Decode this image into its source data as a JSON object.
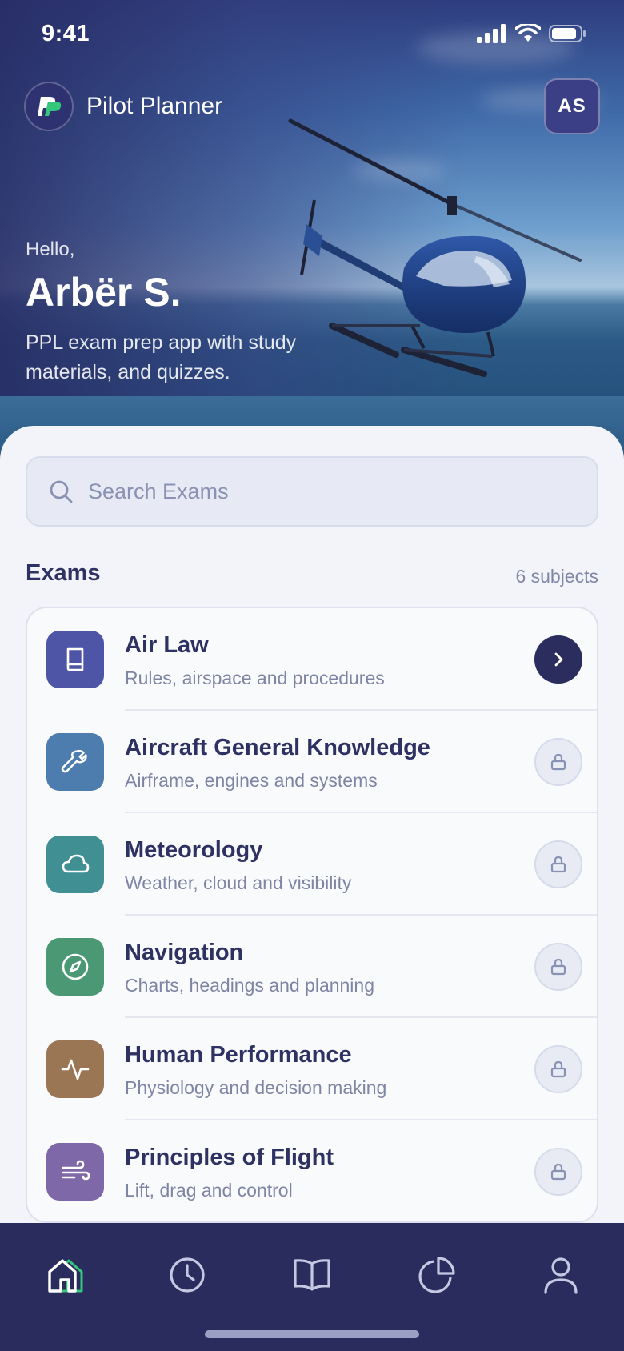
{
  "status_bar": {
    "time": "9:41"
  },
  "header": {
    "app_name": "Pilot Planner",
    "avatar_initials": "AS"
  },
  "hero": {
    "greeting": "Hello,",
    "user_name": "Arbër S.",
    "tagline": "PPL exam prep app with study materials, and quizzes."
  },
  "search": {
    "placeholder": "Search Exams"
  },
  "exams": {
    "title": "Exams",
    "count": "6 subjects",
    "items": [
      {
        "title": "Air Law",
        "subtitle": "Rules, airspace and procedures",
        "icon": "book-icon",
        "color": "#4e55a6",
        "status": "open"
      },
      {
        "title": "Aircraft General Knowledge",
        "subtitle": "Airframe, engines and systems",
        "icon": "wrench-icon",
        "color": "#4d7cae",
        "status": "locked"
      },
      {
        "title": "Meteorology",
        "subtitle": "Weather, cloud and visibility",
        "icon": "cloud-icon",
        "color": "#3f8f93",
        "status": "locked"
      },
      {
        "title": "Navigation",
        "subtitle": "Charts, headings and planning",
        "icon": "compass-icon",
        "color": "#4a9874",
        "status": "locked"
      },
      {
        "title": "Human Performance",
        "subtitle": "Physiology and decision making",
        "icon": "activity-icon",
        "color": "#9a7654",
        "status": "locked"
      },
      {
        "title": "Principles of Flight",
        "subtitle": "Lift, drag and control",
        "icon": "wind-icon",
        "color": "#7e68a8",
        "status": "locked"
      }
    ]
  },
  "tabbar": {
    "items": [
      {
        "name": "home",
        "icon": "home-icon",
        "active": true
      },
      {
        "name": "history",
        "icon": "clock-icon",
        "active": false
      },
      {
        "name": "library",
        "icon": "open-book-icon",
        "active": false
      },
      {
        "name": "stats",
        "icon": "pie-chart-icon",
        "active": false
      },
      {
        "name": "profile",
        "icon": "user-icon",
        "active": false
      }
    ]
  },
  "colors": {
    "primary": "#2a2d5e",
    "accent": "#34c77b",
    "background": "#f3f4f9"
  }
}
